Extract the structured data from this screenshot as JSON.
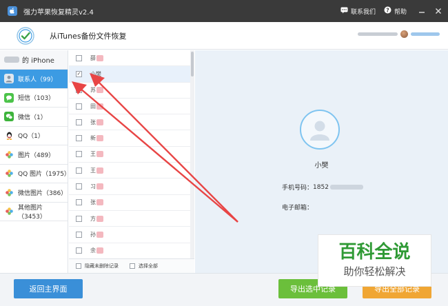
{
  "app": {
    "title": "强力苹果恢复精灵v2.4",
    "contact_label": "联系我们",
    "help_label": "帮助"
  },
  "header": {
    "title": "从iTunes备份文件恢复"
  },
  "sidebar": {
    "device_label": "的 iPhone",
    "items": [
      {
        "label": "联系人（99）",
        "icon": "contacts-icon",
        "active": true
      },
      {
        "label": "短信（103）",
        "icon": "sms-icon"
      },
      {
        "label": "微信（1）",
        "icon": "wechat-icon"
      },
      {
        "label": "QQ（1）",
        "icon": "qq-icon"
      },
      {
        "label": "图片（489）",
        "icon": "photos-icon"
      },
      {
        "label": "QQ 图片（1975）",
        "icon": "qq-photos-icon"
      },
      {
        "label": "微信图片（386）",
        "icon": "wechat-photos-icon"
      },
      {
        "label": "其他图片（3453）",
        "icon": "other-photos-icon"
      }
    ]
  },
  "list": {
    "rows": [
      {
        "name": "薛",
        "checked": false
      },
      {
        "name": "小樊",
        "checked": true
      },
      {
        "name": "苏",
        "checked": false
      },
      {
        "name": "田",
        "checked": false
      },
      {
        "name": "张",
        "checked": false
      },
      {
        "name": "新",
        "checked": false
      },
      {
        "name": "王",
        "checked": false
      },
      {
        "name": "王",
        "checked": false
      },
      {
        "name": "习",
        "checked": false
      },
      {
        "name": "张",
        "checked": false
      },
      {
        "name": "方",
        "checked": false
      },
      {
        "name": "孙",
        "checked": false
      },
      {
        "name": "余",
        "checked": false
      },
      {
        "name": "刘",
        "checked": false
      }
    ],
    "hide_deleted_label": "隐藏未删除记录",
    "select_all_label": "选择全部"
  },
  "detail": {
    "name": "小樊",
    "phone_label": "手机号码：",
    "phone_value": "1852",
    "email_label": "电子邮箱："
  },
  "buttons": {
    "home": "返回主界面",
    "export_selected": "导出选中记录",
    "export_all": "导出全部记录"
  },
  "watermark": {
    "main": "百科全说",
    "sub": "助你轻松解决"
  },
  "colors": {
    "accent": "#3c9be3",
    "export_selected": "#6bbf3b",
    "export_all": "#f0a634",
    "arrow": "#e84545"
  }
}
